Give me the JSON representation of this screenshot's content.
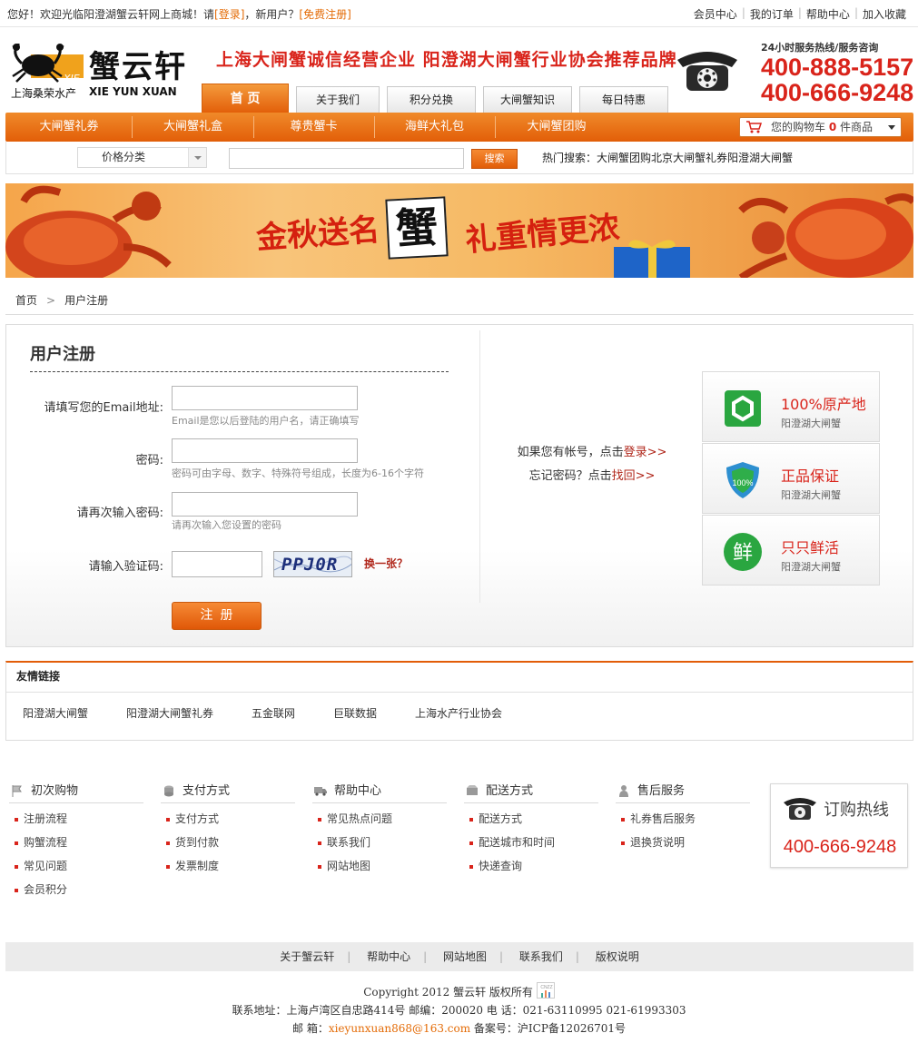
{
  "topbar": {
    "welcome_prefix": "您好！欢迎光临阳澄湖蟹云轩网上商城！请",
    "login": "[登录]",
    "welcome_mid": "，新用户？",
    "register": "[免费注册]",
    "links": [
      "会员中心",
      "我的订单",
      "帮助中心",
      "加入收藏"
    ]
  },
  "logo": {
    "name_cn": "蟹云轩",
    "company": "上海桑荣水产",
    "name_en": "XIE YUN XUAN",
    "mark": "XIE"
  },
  "slogan": "上海大闸蟹诚信经营企业  阳澄湖大闸蟹行业协会推荐品牌",
  "hotline": {
    "caption": "24小时服务热线/服务咨询",
    "numbers": [
      "400-888-5157",
      "400-666-9248"
    ]
  },
  "tabs": [
    "首 页",
    "关于我们",
    "积分兑换",
    "大闸蟹知识",
    "每日特惠"
  ],
  "nav": {
    "items": [
      "大闸蟹礼券",
      "大闸蟹礼盒",
      "尊贵蟹卡",
      "海鲜大礼包",
      "大闸蟹团购"
    ],
    "cart_prefix": "您的购物车",
    "cart_count": "0",
    "cart_suffix": "件商品"
  },
  "search": {
    "category": "价格分类",
    "placeholder": "",
    "button": "搜索",
    "hot_label": "热门搜索：",
    "hot_terms": "大闸蟹团购北京大闸蟹礼券阳澄湖大闸蟹"
  },
  "banner": {
    "text1": "金秋送名",
    "text2": "蟹",
    "text3": "礼重情更浓"
  },
  "breadcrumb": {
    "home": "首页",
    "sep": ">",
    "current": "用户注册"
  },
  "register": {
    "title": "用户注册",
    "email_label": "请填写您的Email地址:",
    "email_hint": "Email是您以后登陆的用户名，请正确填写",
    "password_label": "密码:",
    "password_hint": "密码可由字母、数字、特殊符号组成，长度为6-16个字符",
    "confirm_label": "请再次输入密码:",
    "confirm_hint": "请再次输入您设置的密码",
    "captcha_label": "请输入验证码:",
    "captcha_code": "PPJ0R",
    "refresh": "换一张？",
    "submit": "注册"
  },
  "login_hint": {
    "line1_prefix": "如果您有帐号，点击",
    "line1_link": "登录>>",
    "line2_prefix": "忘记密码？点击",
    "line2_link": "找回>>"
  },
  "promises": [
    {
      "title": "100%原产地",
      "sub": "阳澄湖大闸蟹",
      "icon": "hexagon-icon",
      "badge": ""
    },
    {
      "title": "正品保证",
      "sub": "阳澄湖大闸蟹",
      "icon": "shield-icon",
      "badge": "100%"
    },
    {
      "title": "只只鲜活",
      "sub": "阳澄湖大闸蟹",
      "icon": "fresh-icon",
      "badge": "鲜"
    }
  ],
  "friend_links": {
    "title": "友情链接",
    "items": [
      "阳澄湖大闸蟹",
      "阳澄湖大闸蟹礼券",
      "五金联网",
      "巨联数据",
      "上海水产行业协会"
    ]
  },
  "footer_help": [
    {
      "title": "初次购物",
      "icon": "flag-icon",
      "links": [
        "注册流程",
        "购蟹流程",
        "常见问题",
        "会员积分"
      ]
    },
    {
      "title": "支付方式",
      "icon": "coins-icon",
      "links": [
        "支付方式",
        "货到付款",
        "发票制度"
      ]
    },
    {
      "title": "帮助中心",
      "icon": "truck-icon",
      "links": [
        "常见热点问题",
        "联系我们",
        "网站地图"
      ]
    },
    {
      "title": "配送方式",
      "icon": "box-icon",
      "links": [
        "配送方式",
        "配送城市和时间",
        "快递查询"
      ]
    },
    {
      "title": "售后服务",
      "icon": "user-icon",
      "links": [
        "礼券售后服务",
        "退换货说明"
      ]
    }
  ],
  "order_hotline": {
    "caption": "订购热线",
    "number": "400-666-9248"
  },
  "bottom_nav": [
    "关于蟹云轩",
    "帮助中心",
    "网站地图",
    "联系我们",
    "版权说明"
  ],
  "copyright": {
    "line1": "Copyright 2012 蟹云轩  版权所有",
    "stat_badge": "CNZZ",
    "address": "联系地址：上海卢湾区自忠路414号   邮编：200020    电  话：021-63110995   021-61993303",
    "email_label": "邮  箱：",
    "email": "xieyunxuan868@163.com",
    "icp": "    备案号：沪ICP备12026701号"
  },
  "colors": {
    "accent_orange": "#e25d08",
    "brand_red": "#d9241b"
  }
}
